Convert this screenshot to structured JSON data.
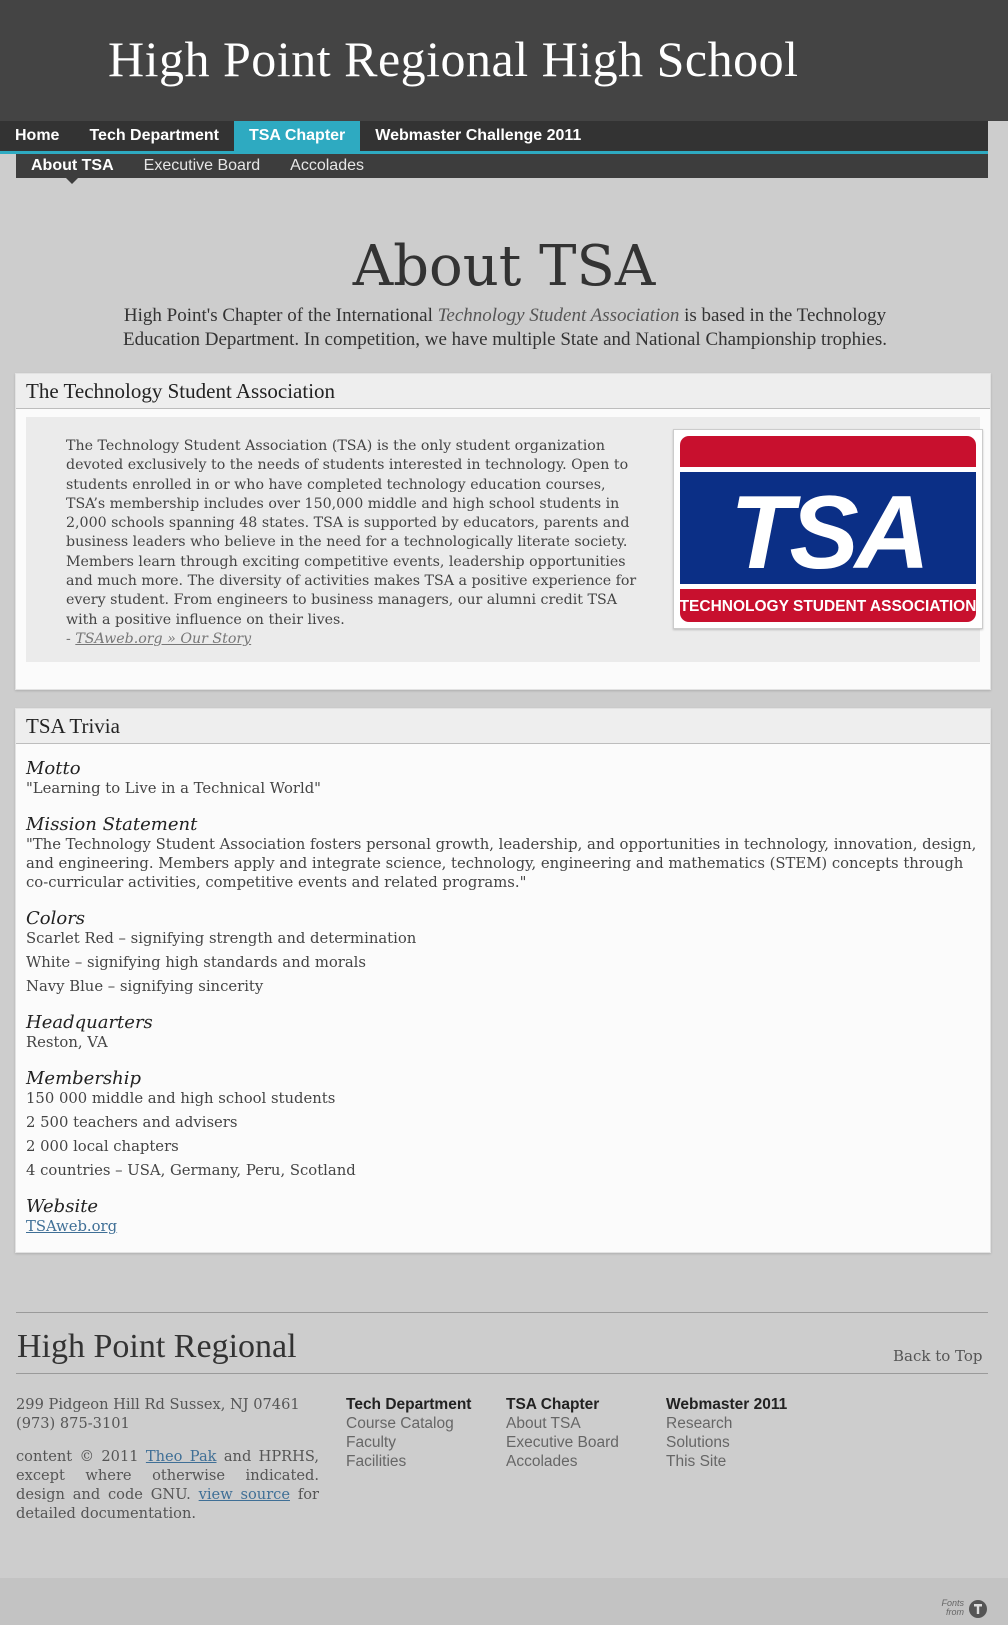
{
  "header": {
    "title": "High Point Regional High School"
  },
  "nav": {
    "items": [
      {
        "label": "Home"
      },
      {
        "label": "Tech Department"
      },
      {
        "label": "TSA Chapter"
      },
      {
        "label": "Webmaster Challenge 2011"
      }
    ],
    "active_index": 2
  },
  "subnav": {
    "items": [
      {
        "label": "About TSA"
      },
      {
        "label": "Executive Board"
      },
      {
        "label": "Accolades"
      }
    ],
    "active_index": 0
  },
  "page": {
    "heading": "About TSA",
    "intro_before": "High Point's Chapter of the International ",
    "intro_em": "Technology Student Association",
    "intro_after": " is based in the Technology Education Department. In competition, we have multiple State and National Championship trophies."
  },
  "about_section": {
    "title": "The Technology Student Association",
    "body": "The Technology Student Association (TSA) is the only student organization devoted exclusively to the needs of students interested in technology. Open to students enrolled in or who have completed technology education courses, TSA’s membership includes over 150,000 middle and high school students in 2,000 schools spanning 48 states. TSA is supported by educators, parents and business leaders who believe in the need for a technologically literate society. Members learn through exciting competitive events, leadership opportunities and much more. The diversity of activities makes TSA a positive experience for every student. From engineers to business managers, our alumni credit TSA with a positive influence on their lives.",
    "source_prefix": "- ",
    "source_link": "TSAweb.org » Our Story",
    "logo": {
      "letters": "TSA",
      "banner": "TECHNOLOGY STUDENT ASSOCIATION"
    },
    "colors": {
      "red": "#c8102e",
      "navy": "#0b2f86"
    }
  },
  "trivia": {
    "title": "TSA Trivia",
    "motto": {
      "heading": "Motto",
      "lines": [
        "\"Learning to Live in a Technical World\""
      ]
    },
    "mission": {
      "heading": "Mission Statement",
      "lines": [
        "\"The Technology Student Association fosters personal growth, leadership, and opportunities in technology, innovation, design, and engineering. Members apply and integrate science, technology, engineering and mathematics (STEM) concepts through co-curricular activities, competitive events and related programs.\""
      ]
    },
    "colors": {
      "heading": "Colors",
      "lines": [
        "Scarlet Red – signifying strength and determination",
        "White – signifying high standards and morals",
        "Navy Blue – signifying sincerity"
      ]
    },
    "headquarters": {
      "heading": "Headquarters",
      "lines": [
        "Reston, VA"
      ]
    },
    "membership": {
      "heading": "Membership",
      "lines": [
        "150 000 middle and high school students",
        "2 500 teachers and advisers",
        "2 000 local chapters",
        "4 countries – USA, Germany, Peru, Scotland"
      ]
    },
    "website": {
      "heading": "Website",
      "link": "TSAweb.org"
    }
  },
  "footer": {
    "name": "High Point Regional",
    "back_to_top": "Back to Top",
    "address": "299 Pidgeon Hill Rd Sussex, NJ 07461",
    "phone": "(973) 875-3101",
    "credit_pre": "content © 2011 ",
    "credit_author": "Theo Pak",
    "credit_mid": " and HPRHS, except where otherwise indicated. design and code GNU. ",
    "credit_link": "view source",
    "credit_post": " for detailed documentation.",
    "columns": [
      {
        "heading": "Tech Department",
        "links": [
          "Course Catalog",
          "Faculty",
          "Facilities"
        ]
      },
      {
        "heading": "TSA Chapter",
        "links": [
          "About TSA",
          "Executive Board",
          "Accolades"
        ]
      },
      {
        "heading": "Webmaster 2011",
        "links": [
          "Research",
          "Solutions",
          "This Site"
        ]
      }
    ],
    "fonts_from": [
      "Fonts",
      "from"
    ]
  }
}
